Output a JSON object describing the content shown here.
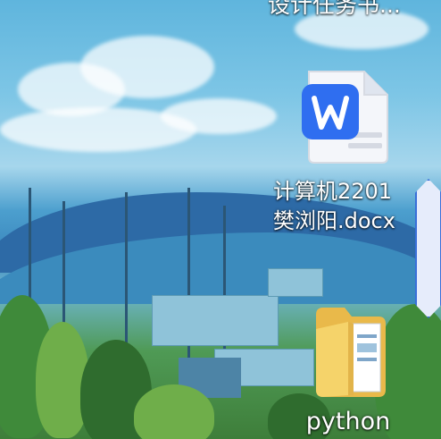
{
  "desktop": {
    "top_item": {
      "label": "设计任务书..."
    },
    "document": {
      "label_line1": "计算机2201",
      "label_line2": "樊浏阳.docx",
      "app": "WPS Writer",
      "icon": "wps-document-icon"
    },
    "folder": {
      "label": "python",
      "icon": "folder-icon"
    }
  },
  "colors": {
    "wps_blue": "#2f6ef0",
    "folder_yellow": "#f5d36a",
    "scroll_border": "#3a6fd8"
  }
}
